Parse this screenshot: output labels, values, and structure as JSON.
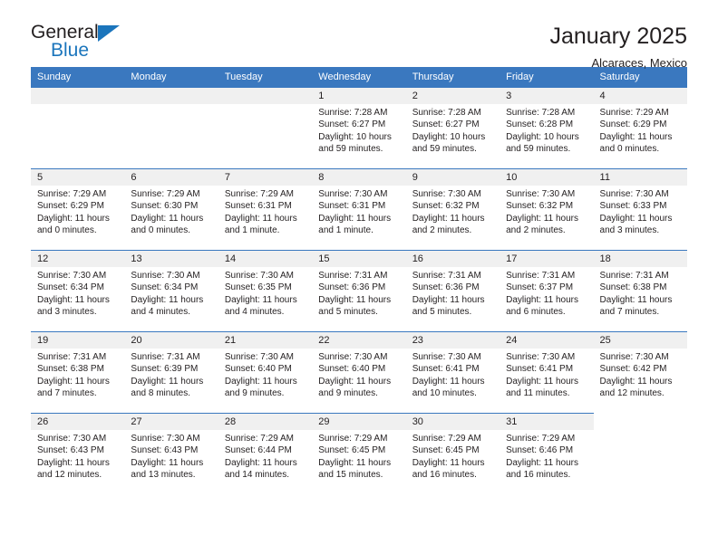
{
  "brand": {
    "name_part1": "General",
    "name_part2": "Blue"
  },
  "header": {
    "title": "January 2025",
    "subtitle": "Alcaraces, Mexico"
  },
  "weekday_headers": [
    "Sunday",
    "Monday",
    "Tuesday",
    "Wednesday",
    "Thursday",
    "Friday",
    "Saturday"
  ],
  "colors": {
    "header_blue": "#3a78bf",
    "brand_blue": "#1b75bc",
    "daynum_bg": "#f0f0f0",
    "text": "#231f20"
  },
  "labels": {
    "sunrise_prefix": "Sunrise:",
    "sunset_prefix": "Sunset:",
    "daylight_prefix": "Daylight:"
  },
  "weeks": [
    [
      {
        "empty": true,
        "strip": true
      },
      {
        "empty": true,
        "strip": true
      },
      {
        "empty": true,
        "strip": true
      },
      {
        "day": "1",
        "sunrise": "Sunrise: 7:28 AM",
        "sunset": "Sunset: 6:27 PM",
        "daylight": "Daylight: 10 hours and 59 minutes."
      },
      {
        "day": "2",
        "sunrise": "Sunrise: 7:28 AM",
        "sunset": "Sunset: 6:27 PM",
        "daylight": "Daylight: 10 hours and 59 minutes."
      },
      {
        "day": "3",
        "sunrise": "Sunrise: 7:28 AM",
        "sunset": "Sunset: 6:28 PM",
        "daylight": "Daylight: 10 hours and 59 minutes."
      },
      {
        "day": "4",
        "sunrise": "Sunrise: 7:29 AM",
        "sunset": "Sunset: 6:29 PM",
        "daylight": "Daylight: 11 hours and 0 minutes."
      }
    ],
    [
      {
        "day": "5",
        "sunrise": "Sunrise: 7:29 AM",
        "sunset": "Sunset: 6:29 PM",
        "daylight": "Daylight: 11 hours and 0 minutes."
      },
      {
        "day": "6",
        "sunrise": "Sunrise: 7:29 AM",
        "sunset": "Sunset: 6:30 PM",
        "daylight": "Daylight: 11 hours and 0 minutes."
      },
      {
        "day": "7",
        "sunrise": "Sunrise: 7:29 AM",
        "sunset": "Sunset: 6:31 PM",
        "daylight": "Daylight: 11 hours and 1 minute."
      },
      {
        "day": "8",
        "sunrise": "Sunrise: 7:30 AM",
        "sunset": "Sunset: 6:31 PM",
        "daylight": "Daylight: 11 hours and 1 minute."
      },
      {
        "day": "9",
        "sunrise": "Sunrise: 7:30 AM",
        "sunset": "Sunset: 6:32 PM",
        "daylight": "Daylight: 11 hours and 2 minutes."
      },
      {
        "day": "10",
        "sunrise": "Sunrise: 7:30 AM",
        "sunset": "Sunset: 6:32 PM",
        "daylight": "Daylight: 11 hours and 2 minutes."
      },
      {
        "day": "11",
        "sunrise": "Sunrise: 7:30 AM",
        "sunset": "Sunset: 6:33 PM",
        "daylight": "Daylight: 11 hours and 3 minutes."
      }
    ],
    [
      {
        "day": "12",
        "sunrise": "Sunrise: 7:30 AM",
        "sunset": "Sunset: 6:34 PM",
        "daylight": "Daylight: 11 hours and 3 minutes."
      },
      {
        "day": "13",
        "sunrise": "Sunrise: 7:30 AM",
        "sunset": "Sunset: 6:34 PM",
        "daylight": "Daylight: 11 hours and 4 minutes."
      },
      {
        "day": "14",
        "sunrise": "Sunrise: 7:30 AM",
        "sunset": "Sunset: 6:35 PM",
        "daylight": "Daylight: 11 hours and 4 minutes."
      },
      {
        "day": "15",
        "sunrise": "Sunrise: 7:31 AM",
        "sunset": "Sunset: 6:36 PM",
        "daylight": "Daylight: 11 hours and 5 minutes."
      },
      {
        "day": "16",
        "sunrise": "Sunrise: 7:31 AM",
        "sunset": "Sunset: 6:36 PM",
        "daylight": "Daylight: 11 hours and 5 minutes."
      },
      {
        "day": "17",
        "sunrise": "Sunrise: 7:31 AM",
        "sunset": "Sunset: 6:37 PM",
        "daylight": "Daylight: 11 hours and 6 minutes."
      },
      {
        "day": "18",
        "sunrise": "Sunrise: 7:31 AM",
        "sunset": "Sunset: 6:38 PM",
        "daylight": "Daylight: 11 hours and 7 minutes."
      }
    ],
    [
      {
        "day": "19",
        "sunrise": "Sunrise: 7:31 AM",
        "sunset": "Sunset: 6:38 PM",
        "daylight": "Daylight: 11 hours and 7 minutes."
      },
      {
        "day": "20",
        "sunrise": "Sunrise: 7:31 AM",
        "sunset": "Sunset: 6:39 PM",
        "daylight": "Daylight: 11 hours and 8 minutes."
      },
      {
        "day": "21",
        "sunrise": "Sunrise: 7:30 AM",
        "sunset": "Sunset: 6:40 PM",
        "daylight": "Daylight: 11 hours and 9 minutes."
      },
      {
        "day": "22",
        "sunrise": "Sunrise: 7:30 AM",
        "sunset": "Sunset: 6:40 PM",
        "daylight": "Daylight: 11 hours and 9 minutes."
      },
      {
        "day": "23",
        "sunrise": "Sunrise: 7:30 AM",
        "sunset": "Sunset: 6:41 PM",
        "daylight": "Daylight: 11 hours and 10 minutes."
      },
      {
        "day": "24",
        "sunrise": "Sunrise: 7:30 AM",
        "sunset": "Sunset: 6:41 PM",
        "daylight": "Daylight: 11 hours and 11 minutes."
      },
      {
        "day": "25",
        "sunrise": "Sunrise: 7:30 AM",
        "sunset": "Sunset: 6:42 PM",
        "daylight": "Daylight: 11 hours and 12 minutes."
      }
    ],
    [
      {
        "day": "26",
        "sunrise": "Sunrise: 7:30 AM",
        "sunset": "Sunset: 6:43 PM",
        "daylight": "Daylight: 11 hours and 12 minutes."
      },
      {
        "day": "27",
        "sunrise": "Sunrise: 7:30 AM",
        "sunset": "Sunset: 6:43 PM",
        "daylight": "Daylight: 11 hours and 13 minutes."
      },
      {
        "day": "28",
        "sunrise": "Sunrise: 7:29 AM",
        "sunset": "Sunset: 6:44 PM",
        "daylight": "Daylight: 11 hours and 14 minutes."
      },
      {
        "day": "29",
        "sunrise": "Sunrise: 7:29 AM",
        "sunset": "Sunset: 6:45 PM",
        "daylight": "Daylight: 11 hours and 15 minutes."
      },
      {
        "day": "30",
        "sunrise": "Sunrise: 7:29 AM",
        "sunset": "Sunset: 6:45 PM",
        "daylight": "Daylight: 11 hours and 16 minutes."
      },
      {
        "day": "31",
        "sunrise": "Sunrise: 7:29 AM",
        "sunset": "Sunset: 6:46 PM",
        "daylight": "Daylight: 11 hours and 16 minutes."
      },
      {
        "empty": true,
        "strip": false
      }
    ]
  ]
}
